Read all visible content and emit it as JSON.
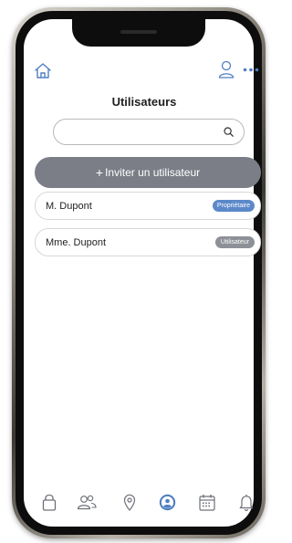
{
  "header": {
    "home_icon": "home-icon",
    "user_icon": "user-icon",
    "more_icon": "more-icon"
  },
  "page": {
    "title": "Utilisateurs"
  },
  "search": {
    "value": "",
    "placeholder": "",
    "icon": "search-icon"
  },
  "invite_button": {
    "plus": "+",
    "label": "Inviter un utilisateur"
  },
  "users": [
    {
      "name": "M. Dupont",
      "role": "Propriétaire",
      "role_color": "#5b88c9"
    },
    {
      "name": "Mme. Dupont",
      "role": "Utilisateur",
      "role_color": "#8d9096"
    }
  ],
  "bottom_nav": [
    {
      "icon": "lock-icon"
    },
    {
      "icon": "users-icon"
    },
    {
      "icon": "location-pin-icon"
    },
    {
      "icon": "account-circle-icon",
      "active": true
    },
    {
      "icon": "calendar-icon"
    },
    {
      "icon": "bell-icon"
    }
  ],
  "colors": {
    "accent": "#4f7fc2",
    "icon": "#6d7078",
    "button": "#7b7e86"
  }
}
